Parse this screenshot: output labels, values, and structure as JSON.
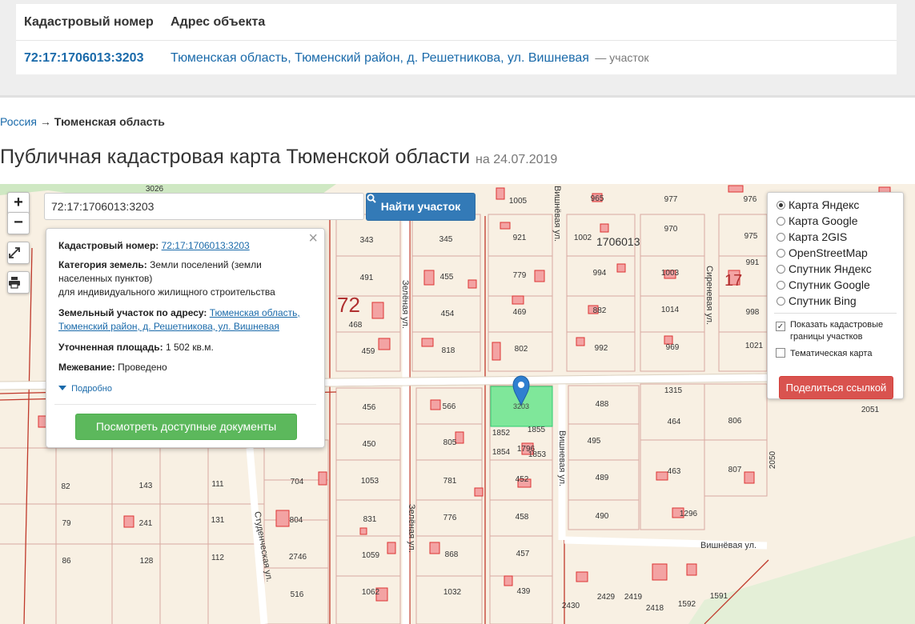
{
  "result_table": {
    "col_cad": "Кадастровый номер",
    "col_addr": "Адрес объекта",
    "row": {
      "cad_number": "72:17:1706013:3203",
      "address": "Тюменская область, Тюменский район, д. Решетникова, ул. Вишневая",
      "type": "— участок"
    }
  },
  "breadcrumb": {
    "root": "Россия",
    "arrow": "→",
    "current": "Тюменская область"
  },
  "page": {
    "title": "Публичная кадастровая карта Тюменской области",
    "date": "на 24.07.2019"
  },
  "map": {
    "zoom_in": "+",
    "zoom_out": "−",
    "fullscreen_icon": "expand-icon",
    "print_icon": "printer-icon",
    "search_value": "72:17:1706013:3203",
    "search_button": "Найти участок",
    "popup": {
      "cad_label": "Кадастровый номер:",
      "cad_value": "72:17:1706013:3203",
      "category_label": "Категория земель:",
      "category_value": "Земли поселений (земли населенных пунктов)",
      "category_sub": "для индивидуального жилищного строительства",
      "address_label": "Земельный участок по адресу:",
      "address_value": "Тюменская область, Тюменский район, д. Решетникова, ул. Вишневая",
      "area_label": "Уточненная площадь:",
      "area_value": "1 502 кв.м.",
      "survey_label": "Межевание:",
      "survey_value": "Проведено",
      "more": "Подробно",
      "docs_button": "Посмотреть доступные документы"
    },
    "layers": [
      {
        "label": "Карта Яндекс",
        "selected": true
      },
      {
        "label": "Карта Google",
        "selected": false
      },
      {
        "label": "Карта 2GIS",
        "selected": false
      },
      {
        "label": "OpenStreetMap",
        "selected": false
      },
      {
        "label": "Спутник Яндекс",
        "selected": false
      },
      {
        "label": "Спутник Google",
        "selected": false
      },
      {
        "label": "Спутник Bing",
        "selected": false
      }
    ],
    "show_borders": {
      "label": "Показать кадастровые границы участков",
      "checked": true
    },
    "thematic": {
      "label": "Тематическая карта",
      "checked": false
    },
    "share_button": "Поделиться ссылкой",
    "streets": {
      "zelenaya": "Зелёная ул.",
      "vishnevaya": "Вишнёвая ул.",
      "vishnevaya2": "Вишневая ул.",
      "sirenevaya": "Сиреневая ул.",
      "studencheskaya": "Студенческая ул."
    },
    "quarters": [
      "72",
      "17",
      "1706013"
    ],
    "selected_parcel": "3203",
    "parcel_numbers": [
      "3026",
      "1005",
      "965",
      "977",
      "976",
      "343",
      "345",
      "921",
      "1002",
      "970",
      "975",
      "491",
      "455",
      "779",
      "994",
      "1003",
      "991",
      "468",
      "454",
      "469",
      "882",
      "1014",
      "998",
      "459",
      "818",
      "802",
      "992",
      "969",
      "1021",
      "1315",
      "456",
      "566",
      "488",
      "464",
      "806",
      "2051",
      "450",
      "805",
      "1852",
      "1855",
      "495",
      "1854",
      "1796",
      "1853",
      "807",
      "2050",
      "82",
      "143",
      "111",
      "704",
      "1053",
      "781",
      "452",
      "489",
      "463",
      "79",
      "241",
      "131",
      "804",
      "831",
      "776",
      "458",
      "490",
      "1296",
      "86",
      "128",
      "112",
      "2746",
      "1059",
      "868",
      "457",
      "516",
      "1062",
      "1032",
      "439",
      "2430",
      "2429",
      "2419",
      "2418",
      "1592",
      "1591"
    ]
  }
}
